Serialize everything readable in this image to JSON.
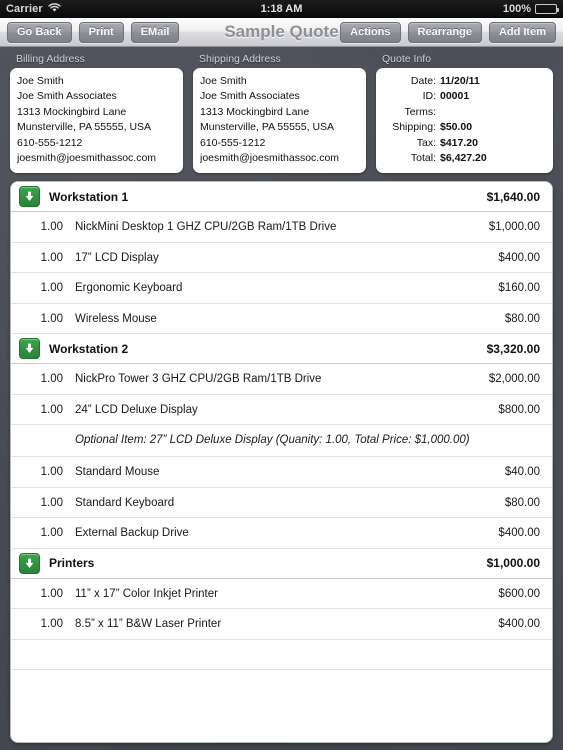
{
  "statusbar": {
    "carrier": "Carrier",
    "wifi_icon": "wifi-icon",
    "time": "1:18 AM",
    "battery_percent": "100%",
    "battery_icon": "battery-full-icon"
  },
  "toolbar": {
    "title": "Sample Quote",
    "left_buttons": [
      {
        "label": "Go Back",
        "name": "go-back-button"
      },
      {
        "label": "Print",
        "name": "print-button"
      },
      {
        "label": "EMail",
        "name": "email-button"
      }
    ],
    "right_buttons": [
      {
        "label": "Actions",
        "name": "actions-button"
      },
      {
        "label": "Rearrange",
        "name": "rearrange-button"
      },
      {
        "label": "Add Item",
        "name": "add-item-button"
      }
    ]
  },
  "billing": {
    "label": "Billing Address",
    "lines": [
      "Joe Smith",
      "Joe Smith Associates",
      "1313 Mockingbird Lane",
      "Munsterville, PA 55555, USA",
      "610-555-1212",
      "joesmith@joesmithassoc.com"
    ]
  },
  "shipping": {
    "label": "Shipping Address",
    "lines": [
      "Joe Smith",
      "Joe Smith Associates",
      "1313 Mockingbird Lane",
      "Munsterville, PA 55555, USA",
      "610-555-1212",
      "joesmith@joesmithassoc.com"
    ]
  },
  "quote_info": {
    "label": "Quote Info",
    "rows": [
      {
        "label": "Date:",
        "value": "11/20/11"
      },
      {
        "label": "ID:",
        "value": "00001"
      },
      {
        "label": "Terms:",
        "value": ""
      },
      {
        "label": "Shipping:",
        "value": "$50.00"
      },
      {
        "label": "Tax:",
        "value": "$417.20"
      },
      {
        "label": "Total:",
        "value": "$6,427.20"
      }
    ]
  },
  "sections": [
    {
      "title": "Workstation 1",
      "total": "$1,640.00",
      "icon": "collapse-down-arrow-icon",
      "items": [
        {
          "qty": "1.00",
          "desc": "NickMini Desktop 1 GHZ CPU/2GB Ram/1TB Drive",
          "price": "$1,000.00"
        },
        {
          "qty": "1.00",
          "desc": "17” LCD Display",
          "price": "$400.00"
        },
        {
          "qty": "1.00",
          "desc": "Ergonomic Keyboard",
          "price": "$160.00"
        },
        {
          "qty": "1.00",
          "desc": "Wireless Mouse",
          "price": "$80.00"
        }
      ]
    },
    {
      "title": "Workstation 2",
      "total": "$3,320.00",
      "icon": "collapse-down-arrow-icon",
      "items": [
        {
          "qty": "1.00",
          "desc": "NickPro Tower 3 GHZ CPU/2GB Ram/1TB Drive",
          "price": "$2,000.00"
        },
        {
          "qty": "1.00",
          "desc": "24” LCD Deluxe Display",
          "price": "$800.00"
        },
        {
          "optional": "Optional Item: 27” LCD Deluxe Display (Quanity: 1.00, Total Price: $1,000.00)"
        },
        {
          "qty": "1.00",
          "desc": "Standard Mouse",
          "price": "$40.00"
        },
        {
          "qty": "1.00",
          "desc": "Standard Keyboard",
          "price": "$80.00"
        },
        {
          "qty": "1.00",
          "desc": "External Backup Drive",
          "price": "$400.00"
        }
      ]
    },
    {
      "title": "Printers",
      "total": "$1,000.00",
      "icon": "collapse-down-arrow-icon",
      "items": [
        {
          "qty": "1.00",
          "desc": "11” x 17” Color Inkjet Printer",
          "price": "$600.00"
        },
        {
          "qty": "1.00",
          "desc": "8.5” x 11” B&W Laser Printer",
          "price": "$400.00"
        }
      ]
    }
  ],
  "colors": {
    "background": "#4b4e56",
    "accent_green": "#2f9340",
    "toolbar_button": "#8b8e95",
    "title_text": "#8d9097"
  }
}
